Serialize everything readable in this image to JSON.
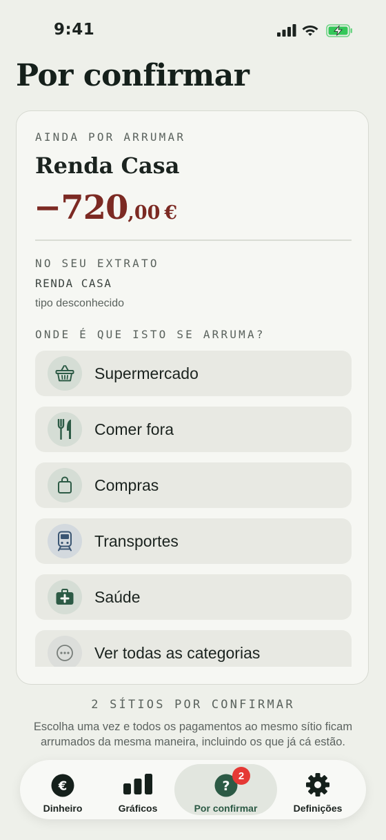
{
  "status_bar": {
    "time": "9:41"
  },
  "page": {
    "title": "Por confirmar"
  },
  "card": {
    "eyebrow": "AINDA POR ARRUMAR",
    "merchant": "Renda Casa",
    "amount": {
      "integer": "−720",
      "decimal": ",00",
      "currency": "€"
    },
    "statement_heading": "NO SEU EXTRATO",
    "statement_name": "RENDA CASA",
    "statement_type": "tipo desconhecido",
    "question": "ONDE É QUE ISTO SE ARRUMA?",
    "categories": [
      {
        "label": "Supermercado",
        "icon": "basket-icon"
      },
      {
        "label": "Comer fora",
        "icon": "fork-knife-icon"
      },
      {
        "label": "Compras",
        "icon": "shopping-bag-icon"
      },
      {
        "label": "Transportes",
        "icon": "train-icon"
      },
      {
        "label": "Saúde",
        "icon": "first-aid-kit-icon"
      },
      {
        "label": "Ver todas as categorias",
        "icon": "more-dots-icon"
      }
    ]
  },
  "footer": {
    "eyebrow": "2 SÍTIOS POR CONFIRMAR",
    "text": "Escolha uma vez e todos os pagamentos ao mesmo sítio ficam arrumados da mesma maneira, incluindo os que já cá estão."
  },
  "tabbar": {
    "tabs": [
      {
        "label": "Dinheiro",
        "icon": "euro-icon"
      },
      {
        "label": "Gráficos",
        "icon": "bar-chart-icon"
      },
      {
        "label": "Por confirmar",
        "icon": "question-icon",
        "badge": "2",
        "active": true
      },
      {
        "label": "Definições",
        "icon": "gear-icon"
      }
    ]
  },
  "colors": {
    "background": "#eef0ea",
    "accent_green": "#2c5a45",
    "amount_red": "#7c2a23",
    "badge_red": "#e53935",
    "battery_green": "#34c759"
  }
}
